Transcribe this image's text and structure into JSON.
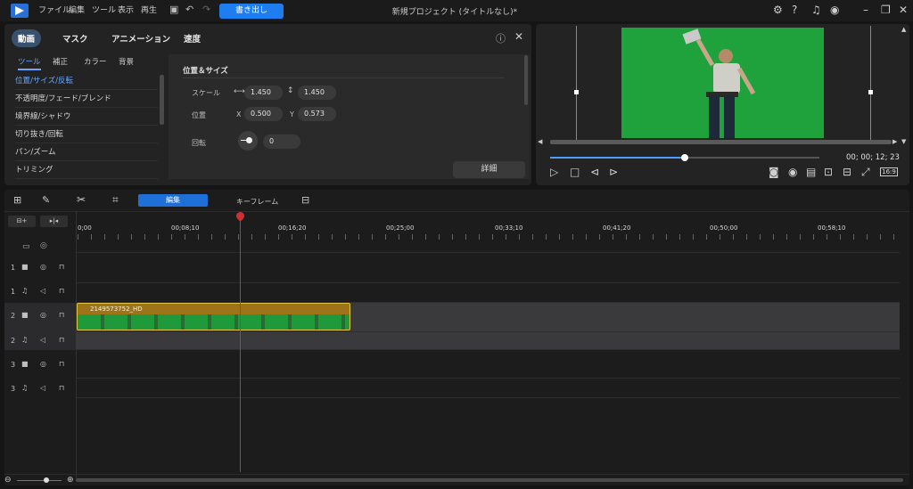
{
  "menu": [
    "ファイル",
    "編集",
    "ツール",
    "表示",
    "再生"
  ],
  "export_label": "書き出し",
  "window_title": "新規プロジェクト (タイトルなし)*",
  "props": {
    "main_tabs": [
      "動画",
      "マスク",
      "アニメーション",
      "速度"
    ],
    "sub_tabs": [
      "ツール",
      "補正",
      "カラー",
      "背景"
    ],
    "side_items": [
      "位置/サイズ/反転",
      "不透明度/フェード/ブレンド",
      "境界線/シャドウ",
      "切り抜き/回転",
      "パン/ズーム",
      "トリミング"
    ],
    "section_title": "位置＆サイズ",
    "scale_label": "スケール",
    "scale_w": "1.450",
    "scale_h": "1.450",
    "position_label": "位置",
    "x_label": "X",
    "x_value": "0.500",
    "y_label": "Y",
    "y_value": "0.573",
    "rotate_label": "回転",
    "rotate_value": "0",
    "detail_label": "詳細"
  },
  "preview": {
    "timecode": "00; 00; 12; 23",
    "aspect": "16:9",
    "progress": 0.5
  },
  "timeline": {
    "edit_label": "編集",
    "keyframe_label": "キーフレーム",
    "ruler": [
      "0;00",
      "00;08;10",
      "00;16;20",
      "00;25;00",
      "00;33;10",
      "00;41;20",
      "00;50;00",
      "00;58;10"
    ],
    "tracks": [
      {
        "num": "1",
        "type": "video-icon"
      },
      {
        "num": "1",
        "type": "audio-icon"
      },
      {
        "num": "2",
        "type": "video-icon"
      },
      {
        "num": "2",
        "type": "audio-icon"
      },
      {
        "num": "3",
        "type": "video-icon"
      },
      {
        "num": "3",
        "type": "audio-icon"
      }
    ],
    "clip_name": "2149573752_HD"
  }
}
